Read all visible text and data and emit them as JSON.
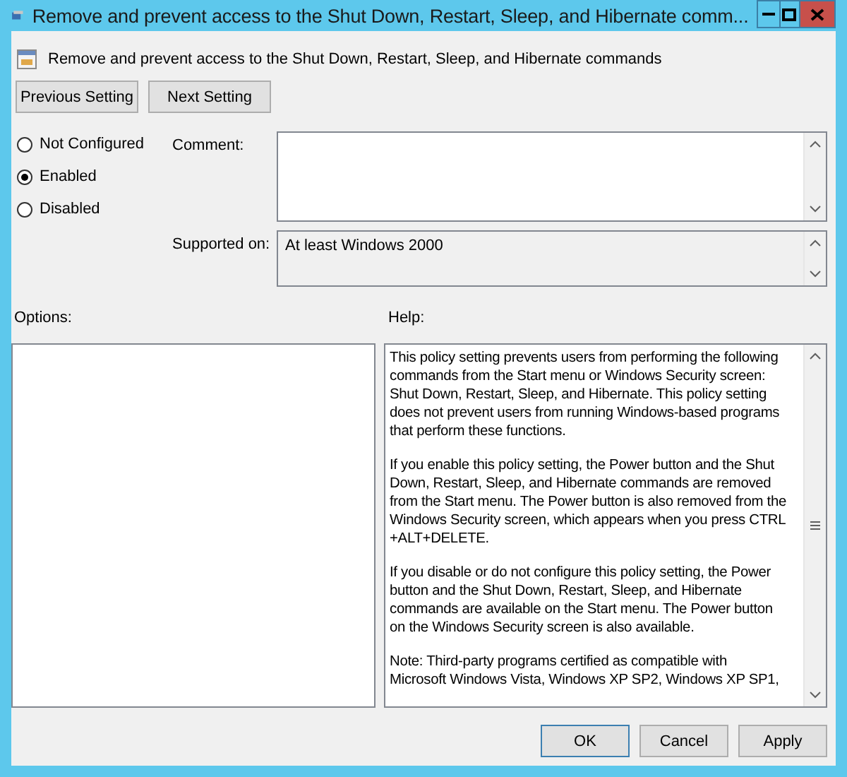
{
  "window": {
    "title": "Remove and prevent access to the Shut Down, Restart, Sleep, and Hibernate comm..."
  },
  "header": {
    "title": "Remove and prevent access to the Shut Down, Restart, Sleep, and Hibernate commands"
  },
  "nav_buttons": [
    "Previous Setting",
    "Next Setting"
  ],
  "states": [
    {
      "label": "Not Configured",
      "selected": false
    },
    {
      "label": "Enabled",
      "selected": true
    },
    {
      "label": "Disabled",
      "selected": false
    }
  ],
  "comment": {
    "label": "Comment:"
  },
  "supported_on": {
    "label": "Supported on:",
    "value": "At least Windows 2000"
  },
  "options": {
    "label": "Options:"
  },
  "help": {
    "label": "Help:",
    "paragraphs": [
      [
        "This policy setting prevents users from performing the following",
        "commands from the Start menu or Windows Security screen:",
        "Shut Down, Restart, Sleep, and Hibernate. This policy setting",
        "does not prevent users from running Windows-based programs",
        "that perform these functions."
      ],
      [
        "If you enable this policy setting, the Power button and the Shut",
        "Down, Restart, Sleep, and Hibernate commands are removed",
        "from the Start menu. The Power button is also removed from the",
        "Windows Security screen, which appears when you press CTRL",
        "+ALT+DELETE."
      ],
      [
        "If you disable or do not configure this policy setting, the Power",
        "button and the Shut Down, Restart, Sleep, and Hibernate",
        "commands are available on the Start menu. The Power button",
        "on the Windows Security screen is also available."
      ],
      [
        "Note: Third-party programs certified as compatible with",
        "Microsoft Windows Vista, Windows XP SP2, Windows XP SP1,"
      ]
    ]
  },
  "footer_buttons": [
    "OK",
    "Cancel",
    "Apply"
  ]
}
